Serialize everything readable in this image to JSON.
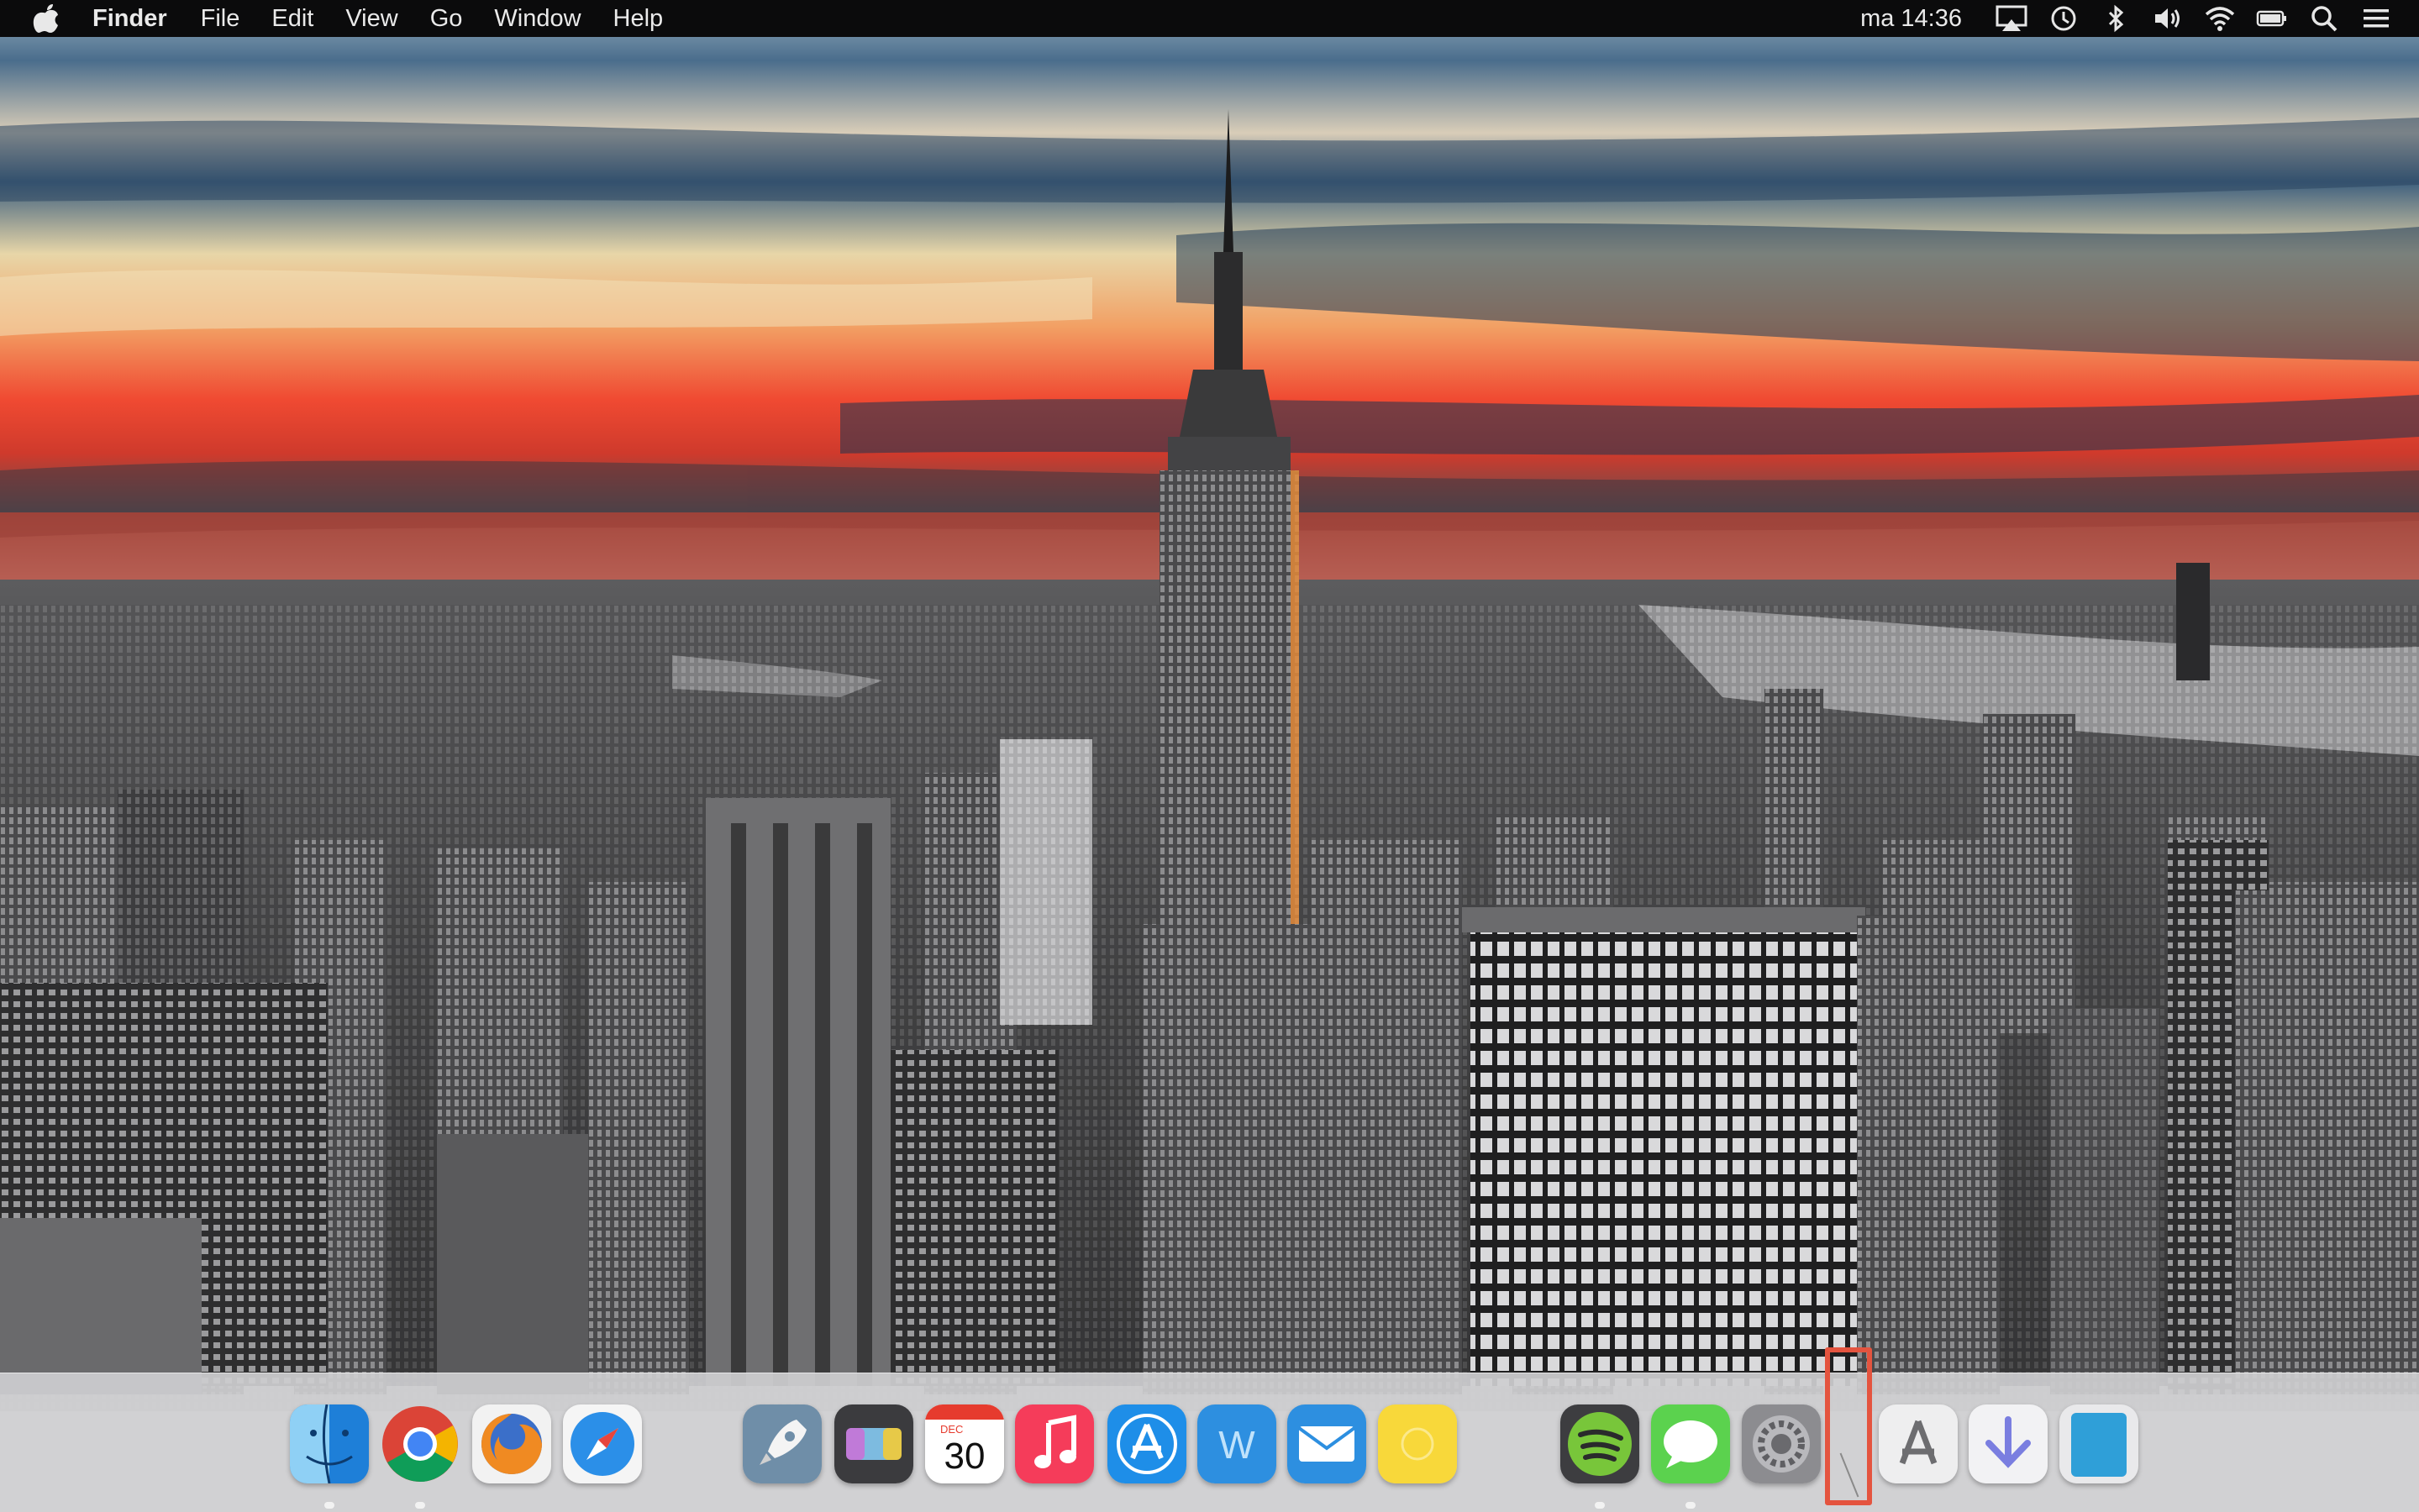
{
  "menubar": {
    "apple_menu_icon": "apple-icon",
    "app_name": "Finder",
    "menus": [
      "File",
      "Edit",
      "View",
      "Go",
      "Window",
      "Help"
    ],
    "clock": "ma 14:36",
    "status_icons": [
      "airplay-icon",
      "time-machine-icon",
      "bluetooth-icon",
      "volume-icon",
      "wifi-icon",
      "battery-icon",
      "spotlight-icon",
      "notification-center-icon"
    ]
  },
  "desktop": {
    "wallpaper": "city-skyline-sunset-photo"
  },
  "dock": {
    "items": [
      {
        "name": "Finder",
        "icon": "finder-icon",
        "running": true
      },
      {
        "name": "Google Chrome",
        "icon": "chrome-icon",
        "running": true
      },
      {
        "name": "Firefox",
        "icon": "firefox-icon",
        "running": false
      },
      {
        "name": "Safari",
        "icon": "safari-icon",
        "running": false
      },
      {
        "name": "Launchpad",
        "icon": "launchpad-icon",
        "running": false
      },
      {
        "name": "Mission Control",
        "icon": "mission-control-icon",
        "running": false
      },
      {
        "name": "Calendar",
        "icon": "calendar-icon",
        "running": false,
        "month": "DEC",
        "day": "30"
      },
      {
        "name": "iTunes",
        "icon": "itunes-icon",
        "running": false
      },
      {
        "name": "App Store",
        "icon": "app-store-icon",
        "running": false
      },
      {
        "name": "Word",
        "icon": "word-icon",
        "running": false,
        "glyph": "W"
      },
      {
        "name": "Mail",
        "icon": "mail-icon",
        "running": false
      },
      {
        "name": "Notes",
        "icon": "notes-icon",
        "running": false
      },
      {
        "name": "Spotify",
        "icon": "spotify-icon",
        "running": true
      },
      {
        "name": "Messages",
        "icon": "messages-icon",
        "running": true
      },
      {
        "name": "System Preferences",
        "icon": "system-preferences-icon",
        "running": false
      },
      {
        "name": "Applications",
        "icon": "applications-folder-icon",
        "running": false
      },
      {
        "name": "Downloads",
        "icon": "downloads-folder-icon",
        "running": false
      },
      {
        "name": "Documents",
        "icon": "documents-stack-icon",
        "running": false
      }
    ],
    "highlight": "dock-separator",
    "colors": {
      "highlight_border": "#e4543f",
      "dock_background": "#cdcdd0",
      "menubar": "#0b0b0c"
    }
  }
}
